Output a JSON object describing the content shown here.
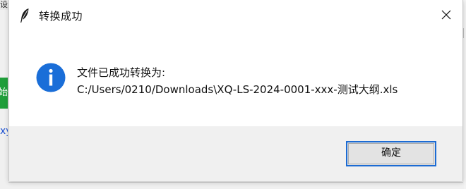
{
  "background": {
    "top_fragment_text": "设",
    "green_button_text": "始",
    "link_fragment_text": "xy"
  },
  "dialog": {
    "title": "转换成功",
    "title_icon": "feather-icon",
    "close_icon": "close-icon",
    "info_icon": "info-icon",
    "message_line1": "文件已成功转换为:",
    "message_line2": "C:/Users/0210/Downloads\\XQ-LS-2024-0001-xxx-测试大纲.xls",
    "ok_label": "确定"
  },
  "colors": {
    "accent": "#1c6bd3",
    "info_icon_fill": "#1a6ed8",
    "bg_green": "#1f9e3a",
    "link": "#1a4fd0"
  }
}
